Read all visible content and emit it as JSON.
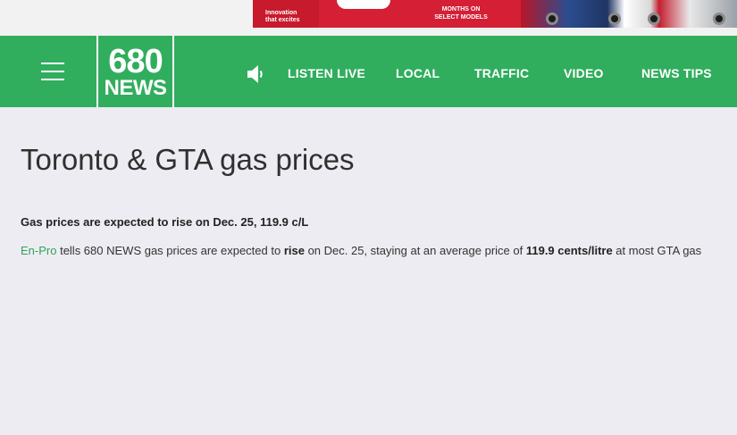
{
  "ad": {
    "brand_line1": "Innovation",
    "brand_line2": "that excites",
    "offer_line1": "MONTHS ON",
    "offer_line2": "SELECT MODELS"
  },
  "nav": {
    "logo_number": "680",
    "logo_word": "NEWS",
    "items": [
      {
        "label": "LISTEN LIVE"
      },
      {
        "label": "LOCAL"
      },
      {
        "label": "TRAFFIC"
      },
      {
        "label": "VIDEO"
      },
      {
        "label": "NEWS TIPS"
      }
    ],
    "speaker_icon": "speaker-icon",
    "menu_icon": "hamburger-menu-icon",
    "accent_color": "#31ad5e"
  },
  "page": {
    "title": "Toronto & GTA gas prices",
    "headline": "Gas prices are expected to rise on Dec. 25, 119.9 c/L",
    "body": {
      "source_link": "En-Pro",
      "part1": " tells 680 NEWS gas prices are expected to ",
      "bold1": "rise",
      "part2": " on Dec. 25, staying at an average price of ",
      "bold2": "119.9 cents/litre",
      "part3": " at most GTA gas"
    }
  }
}
